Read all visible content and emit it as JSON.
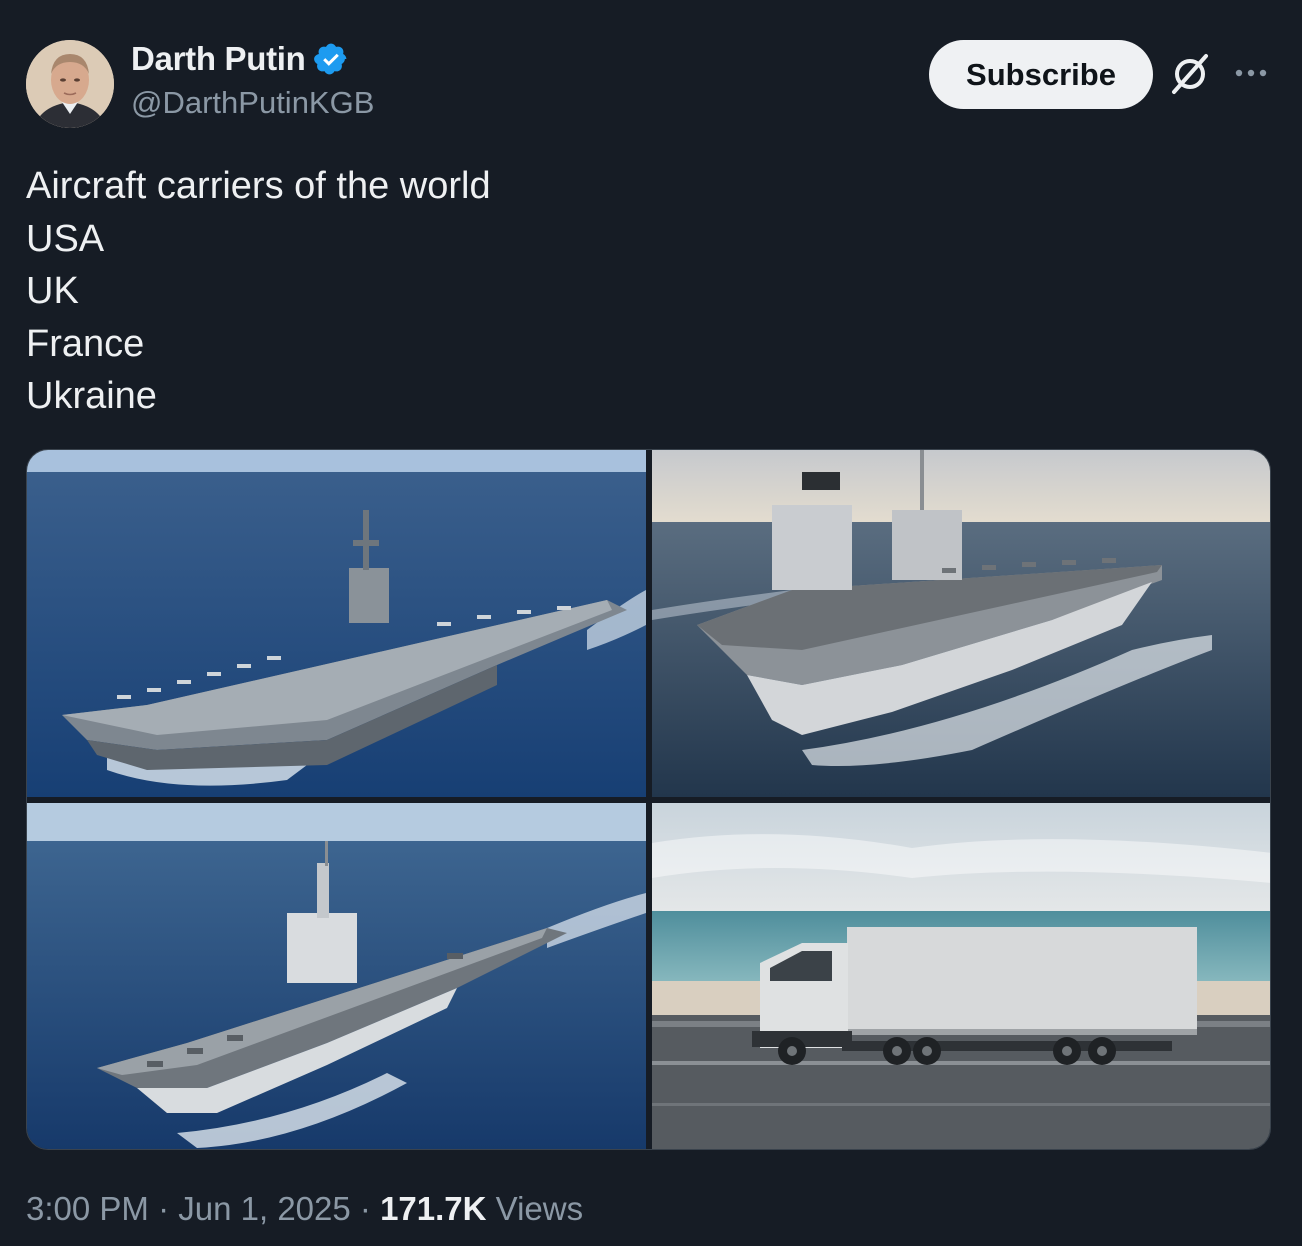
{
  "author": {
    "name": "Darth Putin",
    "handle": "@DarthPutinKGB",
    "verified": true,
    "verified_color": "#1d9bf0"
  },
  "header": {
    "subscribe_label": "Subscribe",
    "grok_icon": "grok-icon",
    "more_icon": "more-options-icon"
  },
  "tweet": {
    "lines": [
      "Aircraft carriers of the world",
      "USA",
      "UK",
      "France",
      "Ukraine"
    ]
  },
  "media": [
    {
      "subject": "aircraft carrier at sea"
    },
    {
      "subject": "aircraft carrier at sea"
    },
    {
      "subject": "aircraft carrier at sea"
    },
    {
      "subject": "box truck on road by the sea"
    }
  ],
  "meta": {
    "time": "3:00 PM",
    "separator": "·",
    "date": "Jun 1, 2025",
    "views_count": "171.7K",
    "views_label": "Views"
  },
  "colors": {
    "background": "#161c25",
    "text_primary": "#eef0f2",
    "text_secondary": "#8b98a5",
    "subscribe_bg": "#eff1f3"
  }
}
